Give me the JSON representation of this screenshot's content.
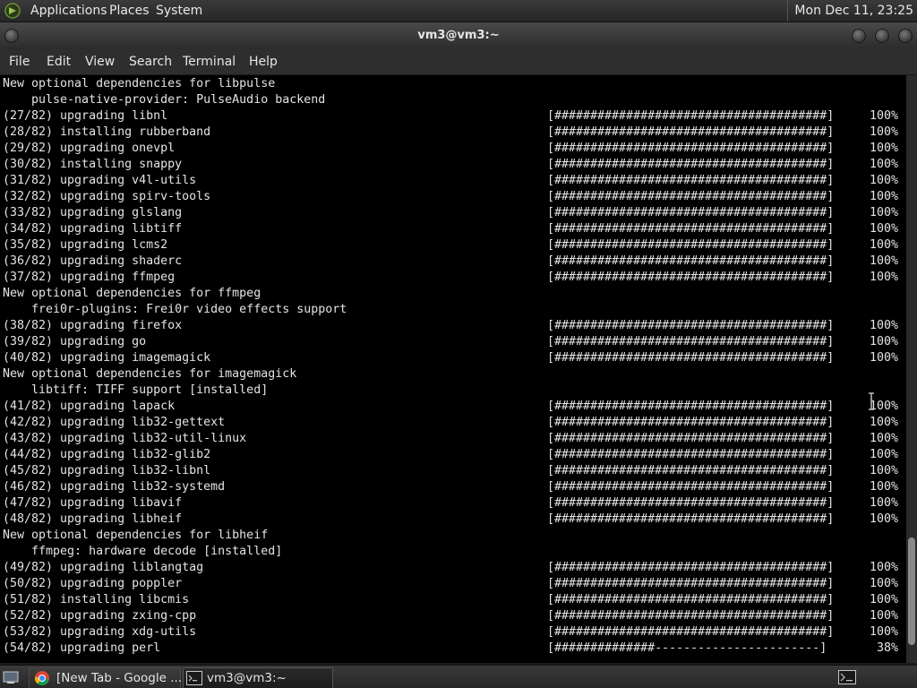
{
  "top_panel": {
    "menus": [
      "Applications",
      "Places",
      "System"
    ],
    "clock": "Mon Dec 11, 23:25"
  },
  "window": {
    "title": "vm3@vm3:~"
  },
  "menubar": [
    "File",
    "Edit",
    "View",
    "Search",
    "Terminal",
    "Help"
  ],
  "terminal": {
    "lines": [
      {
        "text": "New optional dependencies for libpulse"
      },
      {
        "text": "    pulse-native-provider: PulseAudio backend"
      },
      {
        "text": "(27/82) upgrading libnl",
        "bar": "[######################################]",
        "pct": "100%"
      },
      {
        "text": "(28/82) installing rubberband",
        "bar": "[######################################]",
        "pct": "100%"
      },
      {
        "text": "(29/82) upgrading onevpl",
        "bar": "[######################################]",
        "pct": "100%"
      },
      {
        "text": "(30/82) installing snappy",
        "bar": "[######################################]",
        "pct": "100%"
      },
      {
        "text": "(31/82) upgrading v4l-utils",
        "bar": "[######################################]",
        "pct": "100%"
      },
      {
        "text": "(32/82) upgrading spirv-tools",
        "bar": "[######################################]",
        "pct": "100%"
      },
      {
        "text": "(33/82) upgrading glslang",
        "bar": "[######################################]",
        "pct": "100%"
      },
      {
        "text": "(34/82) upgrading libtiff",
        "bar": "[######################################]",
        "pct": "100%"
      },
      {
        "text": "(35/82) upgrading lcms2",
        "bar": "[######################################]",
        "pct": "100%"
      },
      {
        "text": "(36/82) upgrading shaderc",
        "bar": "[######################################]",
        "pct": "100%"
      },
      {
        "text": "(37/82) upgrading ffmpeg",
        "bar": "[######################################]",
        "pct": "100%"
      },
      {
        "text": "New optional dependencies for ffmpeg"
      },
      {
        "text": "    frei0r-plugins: Frei0r video effects support"
      },
      {
        "text": "(38/82) upgrading firefox",
        "bar": "[######################################]",
        "pct": "100%"
      },
      {
        "text": "(39/82) upgrading go",
        "bar": "[######################################]",
        "pct": "100%"
      },
      {
        "text": "(40/82) upgrading imagemagick",
        "bar": "[######################################]",
        "pct": "100%"
      },
      {
        "text": "New optional dependencies for imagemagick"
      },
      {
        "text": "    libtiff: TIFF support [installed]"
      },
      {
        "text": "(41/82) upgrading lapack",
        "bar": "[######################################]",
        "pct": "100%"
      },
      {
        "text": "(42/82) upgrading lib32-gettext",
        "bar": "[######################################]",
        "pct": "100%"
      },
      {
        "text": "(43/82) upgrading lib32-util-linux",
        "bar": "[######################################]",
        "pct": "100%"
      },
      {
        "text": "(44/82) upgrading lib32-glib2",
        "bar": "[######################################]",
        "pct": "100%"
      },
      {
        "text": "(45/82) upgrading lib32-libnl",
        "bar": "[######################################]",
        "pct": "100%"
      },
      {
        "text": "(46/82) upgrading lib32-systemd",
        "bar": "[######################################]",
        "pct": "100%"
      },
      {
        "text": "(47/82) upgrading libavif",
        "bar": "[######################################]",
        "pct": "100%"
      },
      {
        "text": "(48/82) upgrading libheif",
        "bar": "[######################################]",
        "pct": "100%"
      },
      {
        "text": "New optional dependencies for libheif"
      },
      {
        "text": "    ffmpeg: hardware decode [installed]"
      },
      {
        "text": "(49/82) upgrading liblangtag",
        "bar": "[######################################]",
        "pct": "100%"
      },
      {
        "text": "(50/82) upgrading poppler",
        "bar": "[######################################]",
        "pct": "100%"
      },
      {
        "text": "(51/82) installing libcmis",
        "bar": "[######################################]",
        "pct": "100%"
      },
      {
        "text": "(52/82) upgrading zxing-cpp",
        "bar": "[######################################]",
        "pct": "100%"
      },
      {
        "text": "(53/82) upgrading xdg-utils",
        "bar": "[######################################]",
        "pct": "100%"
      },
      {
        "text": "(54/82) upgrading perl",
        "bar": "[##############-----------------------]",
        "pct": " 38%"
      }
    ],
    "scroll_position": 0.97
  },
  "taskbar": {
    "tasks": [
      {
        "label": "[New Tab - Google ...",
        "icon": "chrome-icon",
        "active": false
      },
      {
        "label": "vm3@vm3:~",
        "icon": "terminal-icon",
        "active": true
      }
    ]
  },
  "colors": {
    "terminal_bg": "#000000",
    "terminal_fg": "#e4e4e4",
    "panel_bg": "#2e2e2e"
  }
}
